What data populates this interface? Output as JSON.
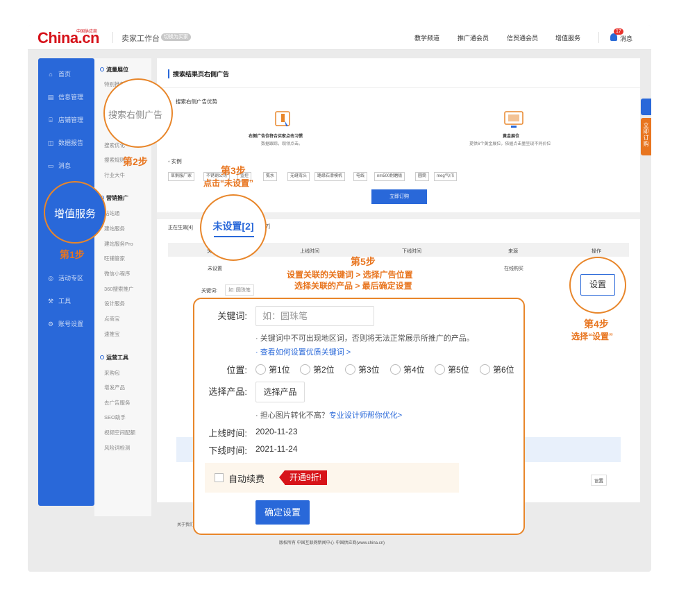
{
  "topbar": {
    "logo": "China.cn",
    "logo_tag": "中国供应商",
    "workspace": "卖家工作台",
    "switch_pill": "切换为买家",
    "nav": [
      "教学频道",
      "推广通会员",
      "信贸通会员",
      "增值服务"
    ],
    "msg_count": "17",
    "msg_label": "消息"
  },
  "sidebar": {
    "items": [
      {
        "label": "首页",
        "icon": "home-icon",
        "glyph": "⌂"
      },
      {
        "label": "信息管理",
        "icon": "document-icon",
        "glyph": "▤"
      },
      {
        "label": "店铺管理",
        "icon": "shop-icon",
        "glyph": "⌸"
      },
      {
        "label": "数据报告",
        "icon": "chart-icon",
        "glyph": "◫"
      },
      {
        "label": "消息",
        "icon": "chat-icon",
        "glyph": "▭"
      },
      {
        "label": "活动专区",
        "icon": "activity-icon",
        "glyph": "◎"
      },
      {
        "label": "工具",
        "icon": "wrench-icon",
        "glyph": "⚒"
      },
      {
        "label": "账号设置",
        "icon": "settings-icon",
        "glyph": "⚙"
      }
    ]
  },
  "submenu": {
    "group1": "流量展位",
    "group1_items": [
      "特别推荐",
      "搜索右侧广告",
      "搜索优化",
      "搜索规则",
      "行业大牛"
    ],
    "group2": "营销推广",
    "group2_items": [
      "站站通",
      "建站服务",
      "建站服务Pro",
      "旺铺管家",
      "微信小程序",
      "360搜索推广",
      "设计服务",
      "点商宝",
      "速推宝"
    ],
    "group3": "运营工具",
    "group3_items": [
      "采购包",
      "增发产品",
      "去广告服务",
      "SEO助手",
      "视频空间配额",
      "风险词检测"
    ]
  },
  "content": {
    "title": "搜索结果页右侧广告",
    "adv_title": "搜索右侧广告优势",
    "feature1_title": "右侧广告位符合买家点击习惯",
    "feature1_desc": "数据跟踪，观领点击。",
    "feature2_title": "黄金展位",
    "feature2_desc": "提供6个黄金展位，依据点击量呈现不同价位",
    "example_label": "实例",
    "example_keywords": [
      "草鹅服厂家",
      "不锈钢公司",
      "监控",
      "氨水",
      "无缝弯头",
      "路缘石滑模机",
      "电线",
      "nm500耐磨板",
      "圆筒",
      "meg气/爪"
    ],
    "buy_button": "立即订购",
    "tab_active": "正在生效[4]",
    "tab_partial": "7]",
    "table_headers": [
      "关键词",
      "上线时间",
      "下线时间",
      "来源",
      "操作"
    ],
    "row_status": "未设置",
    "row_source": "在线购买",
    "row_keyword_label": "关键词:",
    "row_keyword_placeholder": "如: 圆珠笔",
    "row_action": "设置",
    "row2_action": "设置"
  },
  "footer": {
    "line1": "关于我们",
    "line2": "版权所有 中国互联网新闻中心   中国供应商(www.china.cn)"
  },
  "right_tabs": {
    "order_label": "立即订购"
  },
  "annotations": {
    "zoom1": "搜索右侧广告",
    "zoom2": "增值服务",
    "zoom3": "未设置[2]",
    "zoom4": "设置",
    "step1": "第1步",
    "step2": "第2步",
    "step3_title": "第3步",
    "step3_desc": "点击“未设置”",
    "step4_title": "第4步",
    "step4_desc": "选择“设置”",
    "step5_title": "第5步",
    "step5_line1": "设置关联的关键词 > 选择广告位置",
    "step5_line2": "选择关联的产品 > 最后确定设置"
  },
  "modal": {
    "keyword_label": "关键词:",
    "keyword_placeholder": "如：圆珠笔",
    "hint1": "· 关键词中不可出现地区词，否则将无法正常展示所推广的产品。",
    "hint2": "· 查看如何设置优质关键词 >",
    "position_label": "位置:",
    "positions": [
      "第1位",
      "第2位",
      "第3位",
      "第4位",
      "第5位",
      "第6位"
    ],
    "product_label": "选择产品:",
    "product_button": "选择产品",
    "hint3_prefix": "· 担心图片转化不高？",
    "hint3_link": "专业设计师帮你优化>",
    "online_label": "上线时间:",
    "online_value": "2020-11-23",
    "offline_label": "下线时间:",
    "offline_value": "2021-11-24",
    "auto_renew": "自动续费",
    "promo": "开通9折!",
    "confirm": "确定设置"
  },
  "colors": {
    "brand_red": "#d6121a",
    "primary_blue": "#2968d9",
    "annotation_orange": "#e8751f"
  }
}
